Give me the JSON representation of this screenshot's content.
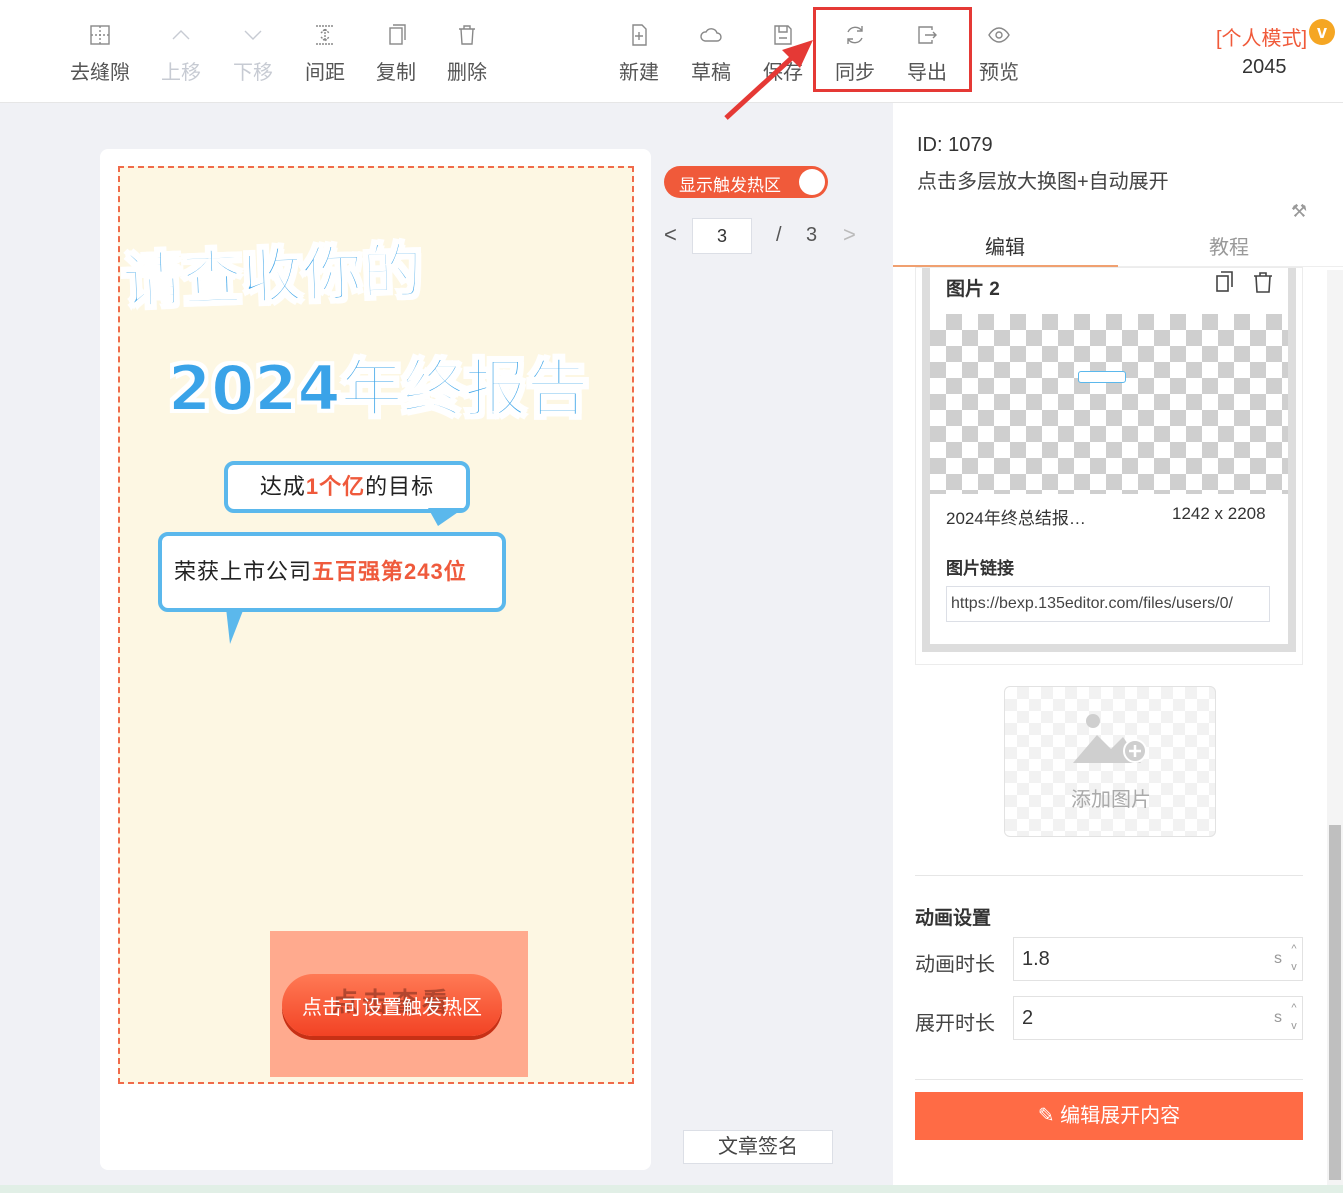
{
  "toolbar": {
    "left": [
      {
        "icon": "remove-gap-icon",
        "label": "去缝隙",
        "disabled": false
      },
      {
        "icon": "move-up-icon",
        "label": "上移",
        "disabled": true
      },
      {
        "icon": "move-down-icon",
        "label": "下移",
        "disabled": true
      },
      {
        "icon": "spacing-icon",
        "label": "间距",
        "disabled": false
      },
      {
        "icon": "copy-icon",
        "label": "复制",
        "disabled": false
      },
      {
        "icon": "trash-icon",
        "label": "删除",
        "disabled": false
      }
    ],
    "right": [
      {
        "icon": "new-file-icon",
        "label": "新建"
      },
      {
        "icon": "cloud-icon",
        "label": "草稿"
      },
      {
        "icon": "save-icon",
        "label": "保存"
      },
      {
        "icon": "sync-icon",
        "label": "同步"
      },
      {
        "icon": "export-icon",
        "label": "导出"
      },
      {
        "icon": "eye-icon",
        "label": "预览"
      }
    ],
    "mode_label": "[个人模式]",
    "vip_badge": "v",
    "mode_number": "2045"
  },
  "canvas": {
    "headline_1": "请查收你的",
    "headline_2": "2024年终报告",
    "bubble_1": {
      "pre": "达成",
      "highlight": "1个亿",
      "post": "的目标"
    },
    "bubble_2": {
      "pre": "荣获上市公司",
      "highlight": "五百强第243位"
    },
    "cta_ghost": "点击查看",
    "cta_label": "点击可设置触发热区"
  },
  "hotspot_toggle": {
    "label": "显示触发热区",
    "on": true
  },
  "pager": {
    "current": "3",
    "separator": "/",
    "total": "3",
    "prev": "<",
    "next": ">"
  },
  "sign_button": "文章签名",
  "panel": {
    "id": "ID: 1079",
    "description": "点击多层放大换图+自动展开",
    "tabs": {
      "edit": "编辑",
      "tutorial": "教程"
    },
    "image": {
      "title": "图片 2",
      "name": "2024年终总结报…",
      "size": "1242 x 2208",
      "link_label": "图片链接",
      "link_value": "https://bexp.135editor.com/files/users/0/"
    },
    "add_image": "添加图片",
    "animation": {
      "title": "动画设置",
      "duration_label": "动画时长",
      "duration_value": "1.8",
      "expand_label": "展开时长",
      "expand_value": "2",
      "unit": "s"
    },
    "edit_expand_button": "编辑展开内容"
  },
  "colors": {
    "accent": "#f05a3a",
    "button": "#ff6b45",
    "bubble_border": "#5bb8ec",
    "annotation": "#e53935"
  }
}
